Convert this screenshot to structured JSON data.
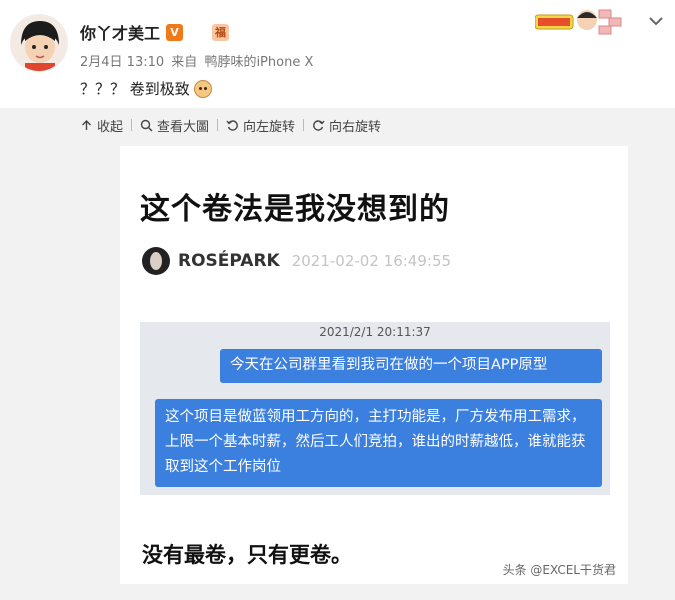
{
  "post": {
    "username": "你丫才美工",
    "verified_badge": "V",
    "level_badge": "福",
    "date": "2月4日 13:10",
    "source_prefix": "来自",
    "source": "鸭脖味的iPhone X",
    "text": "？？？ 卷到极致",
    "emoji_icon": "dog-face-icon"
  },
  "toolbar": {
    "collapse_label": "收起",
    "view_large_label": "查看大圖",
    "rotate_left_label": "向左旋转",
    "rotate_right_label": "向右旋转"
  },
  "image": {
    "title": "这个卷法是我没想到的",
    "author_name": "ROSÉPARK",
    "author_time": "2021-02-02 16:49:55",
    "chat_time": "2021/2/1 20:11:37",
    "bubble1": "今天在公司群里看到我司在做的一个项目APP原型",
    "bubble2": "这个项目是做蓝领用工方向的，主打功能是，厂方发布用工需求，上限一个基本时薪，然后工人们竞拍，谁出的时薪越低，谁就能获取到这个工作岗位",
    "footer": "没有最卷，只有更卷。",
    "watermark": "头条 @EXCEL干货君"
  },
  "colors": {
    "bubble": "#3b7fdf",
    "verified": "#f07a1a",
    "background_grey": "#f2f2f2"
  }
}
